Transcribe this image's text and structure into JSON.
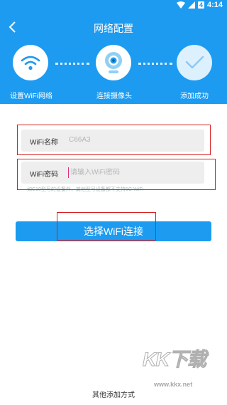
{
  "status_bar": {
    "battery_badge": "4",
    "time": "4:14"
  },
  "header": {
    "title": "网络配置",
    "steps": [
      {
        "label": "设置WiFi网络",
        "icon": "wifi-icon"
      },
      {
        "label": "连接摄像头",
        "icon": "camera-icon"
      },
      {
        "label": "添加成功",
        "icon": "checkmark-icon"
      }
    ]
  },
  "form": {
    "wifi_name_label": "WiFi名称",
    "wifi_name_value": "C66A3",
    "wifi_password_label": "WiFi密码",
    "wifi_password_placeholder": "请输入WiFi密码",
    "wifi_password_value": "",
    "hint": "如C10型号的设备外，其他型号设备都不支持5G WiFi"
  },
  "connect_button": "选择WiFi连接",
  "footer_link": "其他添加方式",
  "watermark": {
    "text": "KK下载",
    "url": "www.kkx.net"
  },
  "colors": {
    "brand": "#1d9bf0",
    "highlight_box": "#d62020"
  }
}
